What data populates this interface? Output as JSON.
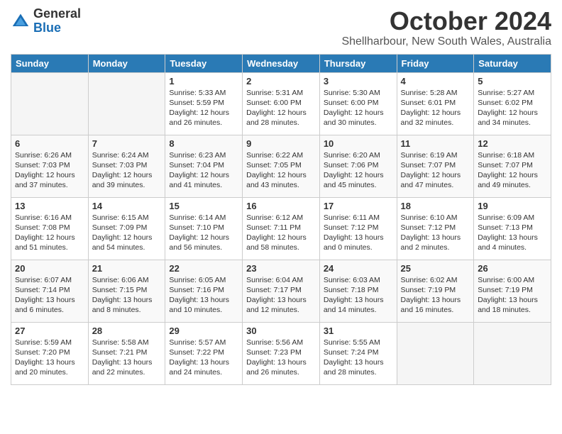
{
  "header": {
    "logo_line1": "General",
    "logo_line2": "Blue",
    "month": "October 2024",
    "location": "Shellharbour, New South Wales, Australia"
  },
  "days_of_week": [
    "Sunday",
    "Monday",
    "Tuesday",
    "Wednesday",
    "Thursday",
    "Friday",
    "Saturday"
  ],
  "weeks": [
    [
      {
        "day": "",
        "info": ""
      },
      {
        "day": "",
        "info": ""
      },
      {
        "day": "1",
        "info": "Sunrise: 5:33 AM\nSunset: 5:59 PM\nDaylight: 12 hours\nand 26 minutes."
      },
      {
        "day": "2",
        "info": "Sunrise: 5:31 AM\nSunset: 6:00 PM\nDaylight: 12 hours\nand 28 minutes."
      },
      {
        "day": "3",
        "info": "Sunrise: 5:30 AM\nSunset: 6:00 PM\nDaylight: 12 hours\nand 30 minutes."
      },
      {
        "day": "4",
        "info": "Sunrise: 5:28 AM\nSunset: 6:01 PM\nDaylight: 12 hours\nand 32 minutes."
      },
      {
        "day": "5",
        "info": "Sunrise: 5:27 AM\nSunset: 6:02 PM\nDaylight: 12 hours\nand 34 minutes."
      }
    ],
    [
      {
        "day": "6",
        "info": "Sunrise: 6:26 AM\nSunset: 7:03 PM\nDaylight: 12 hours\nand 37 minutes."
      },
      {
        "day": "7",
        "info": "Sunrise: 6:24 AM\nSunset: 7:03 PM\nDaylight: 12 hours\nand 39 minutes."
      },
      {
        "day": "8",
        "info": "Sunrise: 6:23 AM\nSunset: 7:04 PM\nDaylight: 12 hours\nand 41 minutes."
      },
      {
        "day": "9",
        "info": "Sunrise: 6:22 AM\nSunset: 7:05 PM\nDaylight: 12 hours\nand 43 minutes."
      },
      {
        "day": "10",
        "info": "Sunrise: 6:20 AM\nSunset: 7:06 PM\nDaylight: 12 hours\nand 45 minutes."
      },
      {
        "day": "11",
        "info": "Sunrise: 6:19 AM\nSunset: 7:07 PM\nDaylight: 12 hours\nand 47 minutes."
      },
      {
        "day": "12",
        "info": "Sunrise: 6:18 AM\nSunset: 7:07 PM\nDaylight: 12 hours\nand 49 minutes."
      }
    ],
    [
      {
        "day": "13",
        "info": "Sunrise: 6:16 AM\nSunset: 7:08 PM\nDaylight: 12 hours\nand 51 minutes."
      },
      {
        "day": "14",
        "info": "Sunrise: 6:15 AM\nSunset: 7:09 PM\nDaylight: 12 hours\nand 54 minutes."
      },
      {
        "day": "15",
        "info": "Sunrise: 6:14 AM\nSunset: 7:10 PM\nDaylight: 12 hours\nand 56 minutes."
      },
      {
        "day": "16",
        "info": "Sunrise: 6:12 AM\nSunset: 7:11 PM\nDaylight: 12 hours\nand 58 minutes."
      },
      {
        "day": "17",
        "info": "Sunrise: 6:11 AM\nSunset: 7:12 PM\nDaylight: 13 hours\nand 0 minutes."
      },
      {
        "day": "18",
        "info": "Sunrise: 6:10 AM\nSunset: 7:12 PM\nDaylight: 13 hours\nand 2 minutes."
      },
      {
        "day": "19",
        "info": "Sunrise: 6:09 AM\nSunset: 7:13 PM\nDaylight: 13 hours\nand 4 minutes."
      }
    ],
    [
      {
        "day": "20",
        "info": "Sunrise: 6:07 AM\nSunset: 7:14 PM\nDaylight: 13 hours\nand 6 minutes."
      },
      {
        "day": "21",
        "info": "Sunrise: 6:06 AM\nSunset: 7:15 PM\nDaylight: 13 hours\nand 8 minutes."
      },
      {
        "day": "22",
        "info": "Sunrise: 6:05 AM\nSunset: 7:16 PM\nDaylight: 13 hours\nand 10 minutes."
      },
      {
        "day": "23",
        "info": "Sunrise: 6:04 AM\nSunset: 7:17 PM\nDaylight: 13 hours\nand 12 minutes."
      },
      {
        "day": "24",
        "info": "Sunrise: 6:03 AM\nSunset: 7:18 PM\nDaylight: 13 hours\nand 14 minutes."
      },
      {
        "day": "25",
        "info": "Sunrise: 6:02 AM\nSunset: 7:19 PM\nDaylight: 13 hours\nand 16 minutes."
      },
      {
        "day": "26",
        "info": "Sunrise: 6:00 AM\nSunset: 7:19 PM\nDaylight: 13 hours\nand 18 minutes."
      }
    ],
    [
      {
        "day": "27",
        "info": "Sunrise: 5:59 AM\nSunset: 7:20 PM\nDaylight: 13 hours\nand 20 minutes."
      },
      {
        "day": "28",
        "info": "Sunrise: 5:58 AM\nSunset: 7:21 PM\nDaylight: 13 hours\nand 22 minutes."
      },
      {
        "day": "29",
        "info": "Sunrise: 5:57 AM\nSunset: 7:22 PM\nDaylight: 13 hours\nand 24 minutes."
      },
      {
        "day": "30",
        "info": "Sunrise: 5:56 AM\nSunset: 7:23 PM\nDaylight: 13 hours\nand 26 minutes."
      },
      {
        "day": "31",
        "info": "Sunrise: 5:55 AM\nSunset: 7:24 PM\nDaylight: 13 hours\nand 28 minutes."
      },
      {
        "day": "",
        "info": ""
      },
      {
        "day": "",
        "info": ""
      }
    ]
  ]
}
